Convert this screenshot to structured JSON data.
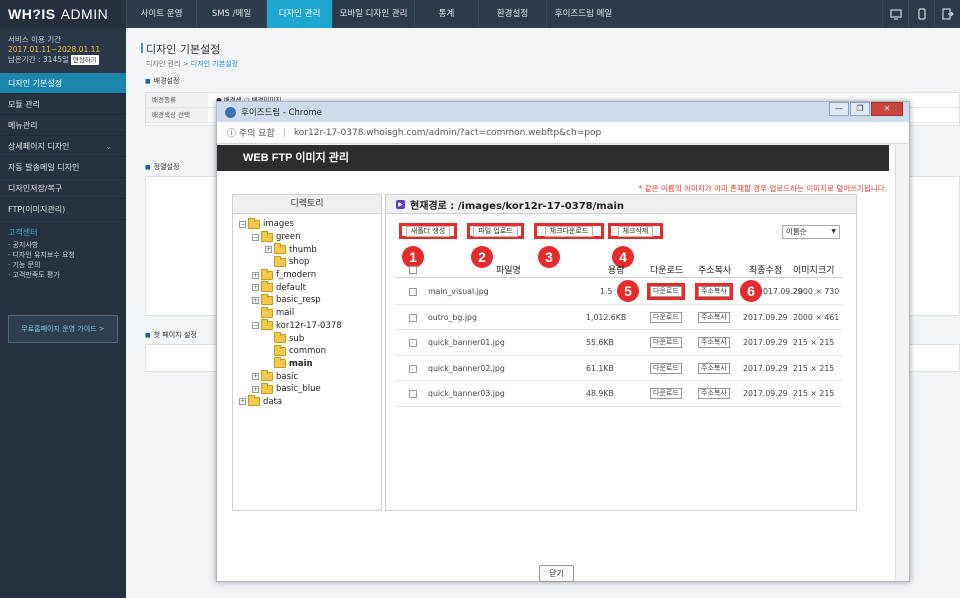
{
  "app": {
    "logo_main": "WH?IS",
    "logo_sub": "ADMIN"
  },
  "topnav": {
    "items": [
      "사이트 운영",
      "SMS /메일",
      "디자인 관리",
      "모바일 디자인 관리",
      "통계",
      "환경설정",
      "후이즈드림 메일"
    ],
    "active_index": 2
  },
  "topicons": [
    "monitor-icon",
    "mobile-icon",
    "logout-icon"
  ],
  "service": {
    "label": "서비스 이용 기간",
    "date_range": "2017.01.11~2028.01.11",
    "remaining": "남은기간 : 3145일",
    "extend_btn": "연장하기"
  },
  "sidebar": {
    "items": [
      "디자인 기본설정",
      "모듈 관리",
      "메뉴관리",
      "상세페이지 디자인",
      "자동 발송메일 디자인",
      "디자인저장/복구",
      "FTP(이미지관리)"
    ],
    "active_index": 0,
    "expand_index": 3
  },
  "customer": {
    "title": "고객센터",
    "items": [
      "· 공지사항",
      "· 디자인 유지보수 요청",
      "· 기능 문의",
      "· 고객만족도 평가"
    ],
    "guide": "무료홈페이지 운영 가이드 >"
  },
  "page": {
    "title": "디자인 기본설정",
    "crumb_parent": "디자인 관리 > ",
    "crumb_current": "디자인 기본설정",
    "sec1": "배경설정",
    "bg_type_label": "배경종류",
    "bg_type_opts": "● 배경색  ○ 배경이미지",
    "bg_color_label": "배경색상 선택",
    "sec2": "정렬설정",
    "sec3": "첫 페이지 설정"
  },
  "popup": {
    "window_title": "후이즈드림 - Chrome",
    "win_btns": [
      "—",
      "❐",
      "✕"
    ],
    "addr_warn": "ⓘ 주의 요함",
    "url": "kor12r-17-0378.whoisgh.com/admin/?act=common.webftp&ch=pop",
    "header": "WEB FTP 이미지 관리",
    "notice": "* 같은 이름의 이미지가 이미 존재할 경우 업로드하는 이미지로 덮어쓰기됩니다.",
    "dir_title": "디렉토리",
    "path": "현재경로 : /images/kor12r-17-0378/main",
    "tree": [
      {
        "label": "images",
        "depth": 0,
        "pm": "−"
      },
      {
        "label": "green",
        "depth": 1,
        "pm": "−"
      },
      {
        "label": "thumb",
        "depth": 2,
        "pm": "+"
      },
      {
        "label": "shop",
        "depth": 2,
        "pm": ""
      },
      {
        "label": "f_modern",
        "depth": 1,
        "pm": "+"
      },
      {
        "label": "default",
        "depth": 1,
        "pm": "+"
      },
      {
        "label": "basic_resp",
        "depth": 1,
        "pm": "+"
      },
      {
        "label": "mail",
        "depth": 1,
        "pm": ""
      },
      {
        "label": "kor12r-17-0378",
        "depth": 1,
        "pm": "−"
      },
      {
        "label": "sub",
        "depth": 2,
        "pm": ""
      },
      {
        "label": "common",
        "depth": 2,
        "pm": ""
      },
      {
        "label": "main",
        "depth": 2,
        "pm": "",
        "selected": true
      },
      {
        "label": "basic",
        "depth": 1,
        "pm": "+"
      },
      {
        "label": "basic_blue",
        "depth": 1,
        "pm": "+"
      },
      {
        "label": "data",
        "depth": 0,
        "pm": "+"
      }
    ],
    "toolbar": {
      "new_folder": "새폴더 생성",
      "upload": "파일 업로드",
      "check_download": "체크다운로드",
      "check_delete": "체크삭제"
    },
    "sort": "이름순",
    "badges": [
      "1",
      "2",
      "3",
      "4",
      "5",
      "6"
    ],
    "columns": [
      "파일명",
      "용량",
      "다운로드",
      "주소복사",
      "최종수정",
      "이미지크기"
    ],
    "files": [
      {
        "name": "main_visual.jpg",
        "size": "1.5",
        "down": "다운로드",
        "copy": "주소복사",
        "date": "2017.09.29",
        "dim": "2000 × 730"
      },
      {
        "name": "outro_bg.jpg",
        "size": "1,012.6KB",
        "down": "다운로드",
        "copy": "주소복사",
        "date": "2017.09.29",
        "dim": "2000 × 461"
      },
      {
        "name": "quick_banner01.jpg",
        "size": "55.6KB",
        "down": "다운로드",
        "copy": "주소복사",
        "date": "2017.09.29",
        "dim": "215 × 215"
      },
      {
        "name": "quick_banner02.jpg",
        "size": "61.1KB",
        "down": "다운로드",
        "copy": "주소복사",
        "date": "2017.09.29",
        "dim": "215 × 215"
      },
      {
        "name": "quick_banner03.jpg",
        "size": "48.9KB",
        "down": "다운로드",
        "copy": "주소복사",
        "date": "2017.09.29",
        "dim": "215 × 215"
      }
    ],
    "close": "닫기",
    "accent": "#e52b2b"
  }
}
